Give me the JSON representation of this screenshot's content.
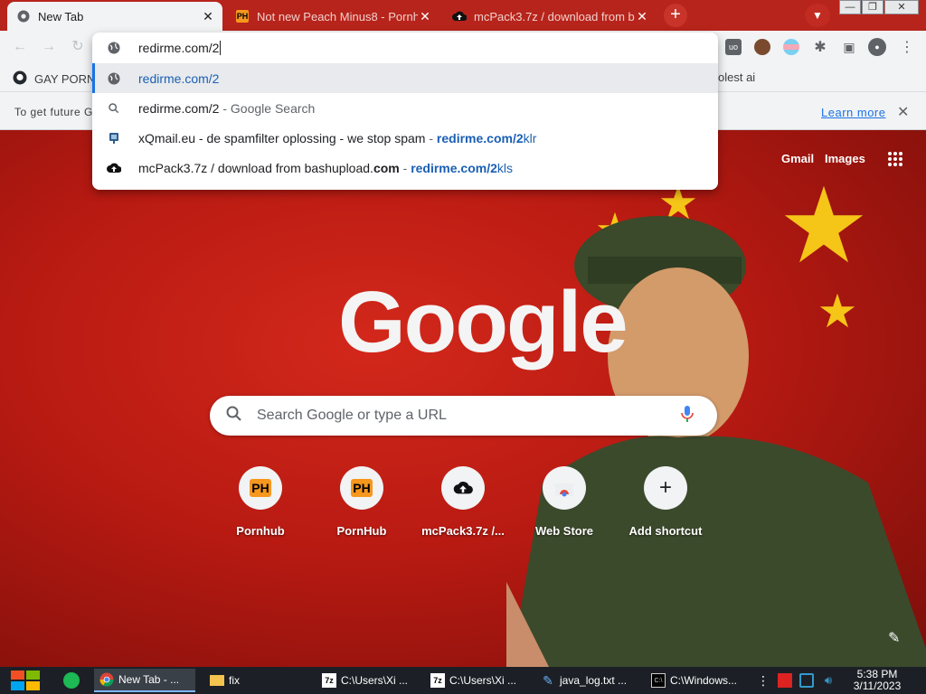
{
  "tabs": [
    {
      "title": "New Tab",
      "favicon": "chrome-icon",
      "active": true
    },
    {
      "title": "Not new Peach Minus8 - Pornh",
      "favicon": "PH",
      "active": false
    },
    {
      "title": "mcPack3.7z / download from b",
      "favicon": "cloud-upload-icon",
      "active": false
    }
  ],
  "omnibox": {
    "typed": "redirme.com/2",
    "suggestions": [
      {
        "icon": "globe-icon",
        "text": "redirme.com/2",
        "suffix": "",
        "url": ""
      },
      {
        "icon": "search-icon",
        "text": "redirme.com/2",
        "suffix": " - Google Search",
        "url": ""
      },
      {
        "icon": "page-icon",
        "text": "xQmail.eu - de spamfilter oplossing - we stop spam",
        "suffix": " - ",
        "url_bold": "redirme.com/2",
        "url_rest": "klr"
      },
      {
        "icon": "cloud-upload-icon",
        "text": "mcPack3.7z / download from bashupload.",
        "text_bold": "com",
        "suffix": " - ",
        "url_bold": "redirme.com/2",
        "url_rest": "kls"
      }
    ]
  },
  "bookmarks": [
    {
      "label": "GAY PORN",
      "icon": "octocat-icon"
    },
    {
      "label": "olest ai",
      "icon": ""
    }
  ],
  "infobar": {
    "text": "To get future G",
    "learn_more": "Learn more"
  },
  "ntp": {
    "links": [
      "Gmail",
      "Images"
    ],
    "logo": "Google",
    "search_placeholder": "Search Google or type a URL",
    "shortcuts": [
      {
        "label": "Pornhub",
        "icon": "PH"
      },
      {
        "label": "PornHub",
        "icon": "PH"
      },
      {
        "label": "mcPack3.7z /...",
        "icon": "cloud-upload-icon"
      },
      {
        "label": "Web Store",
        "icon": "web-store-icon"
      },
      {
        "label": "Add shortcut",
        "icon": "plus-icon"
      }
    ]
  },
  "taskbar": {
    "items": [
      {
        "label": "New Tab - ...",
        "icon": "chrome-icon",
        "active": true
      },
      {
        "label": "fix",
        "icon": "folder-icon",
        "active": false
      },
      {
        "label": "C:\\Users\\Xi ...",
        "icon": "7zip-icon",
        "active": false
      },
      {
        "label": "C:\\Users\\Xi ...",
        "icon": "7zip-icon",
        "active": false
      },
      {
        "label": "java_log.txt ...",
        "icon": "notepad-icon",
        "active": false
      },
      {
        "label": "C:\\Windows...",
        "icon": "cmd-icon",
        "active": false
      }
    ],
    "time": "5:38 PM",
    "date": "3/11/2023"
  }
}
